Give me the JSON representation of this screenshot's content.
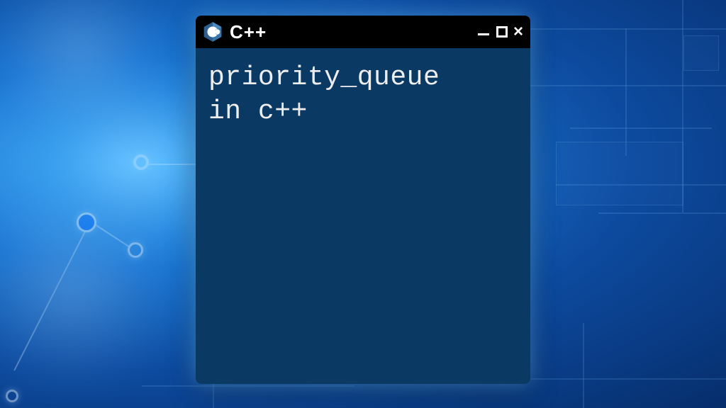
{
  "window": {
    "title": "C++",
    "body_line1": "priority_queue",
    "body_line2": "in c++"
  }
}
